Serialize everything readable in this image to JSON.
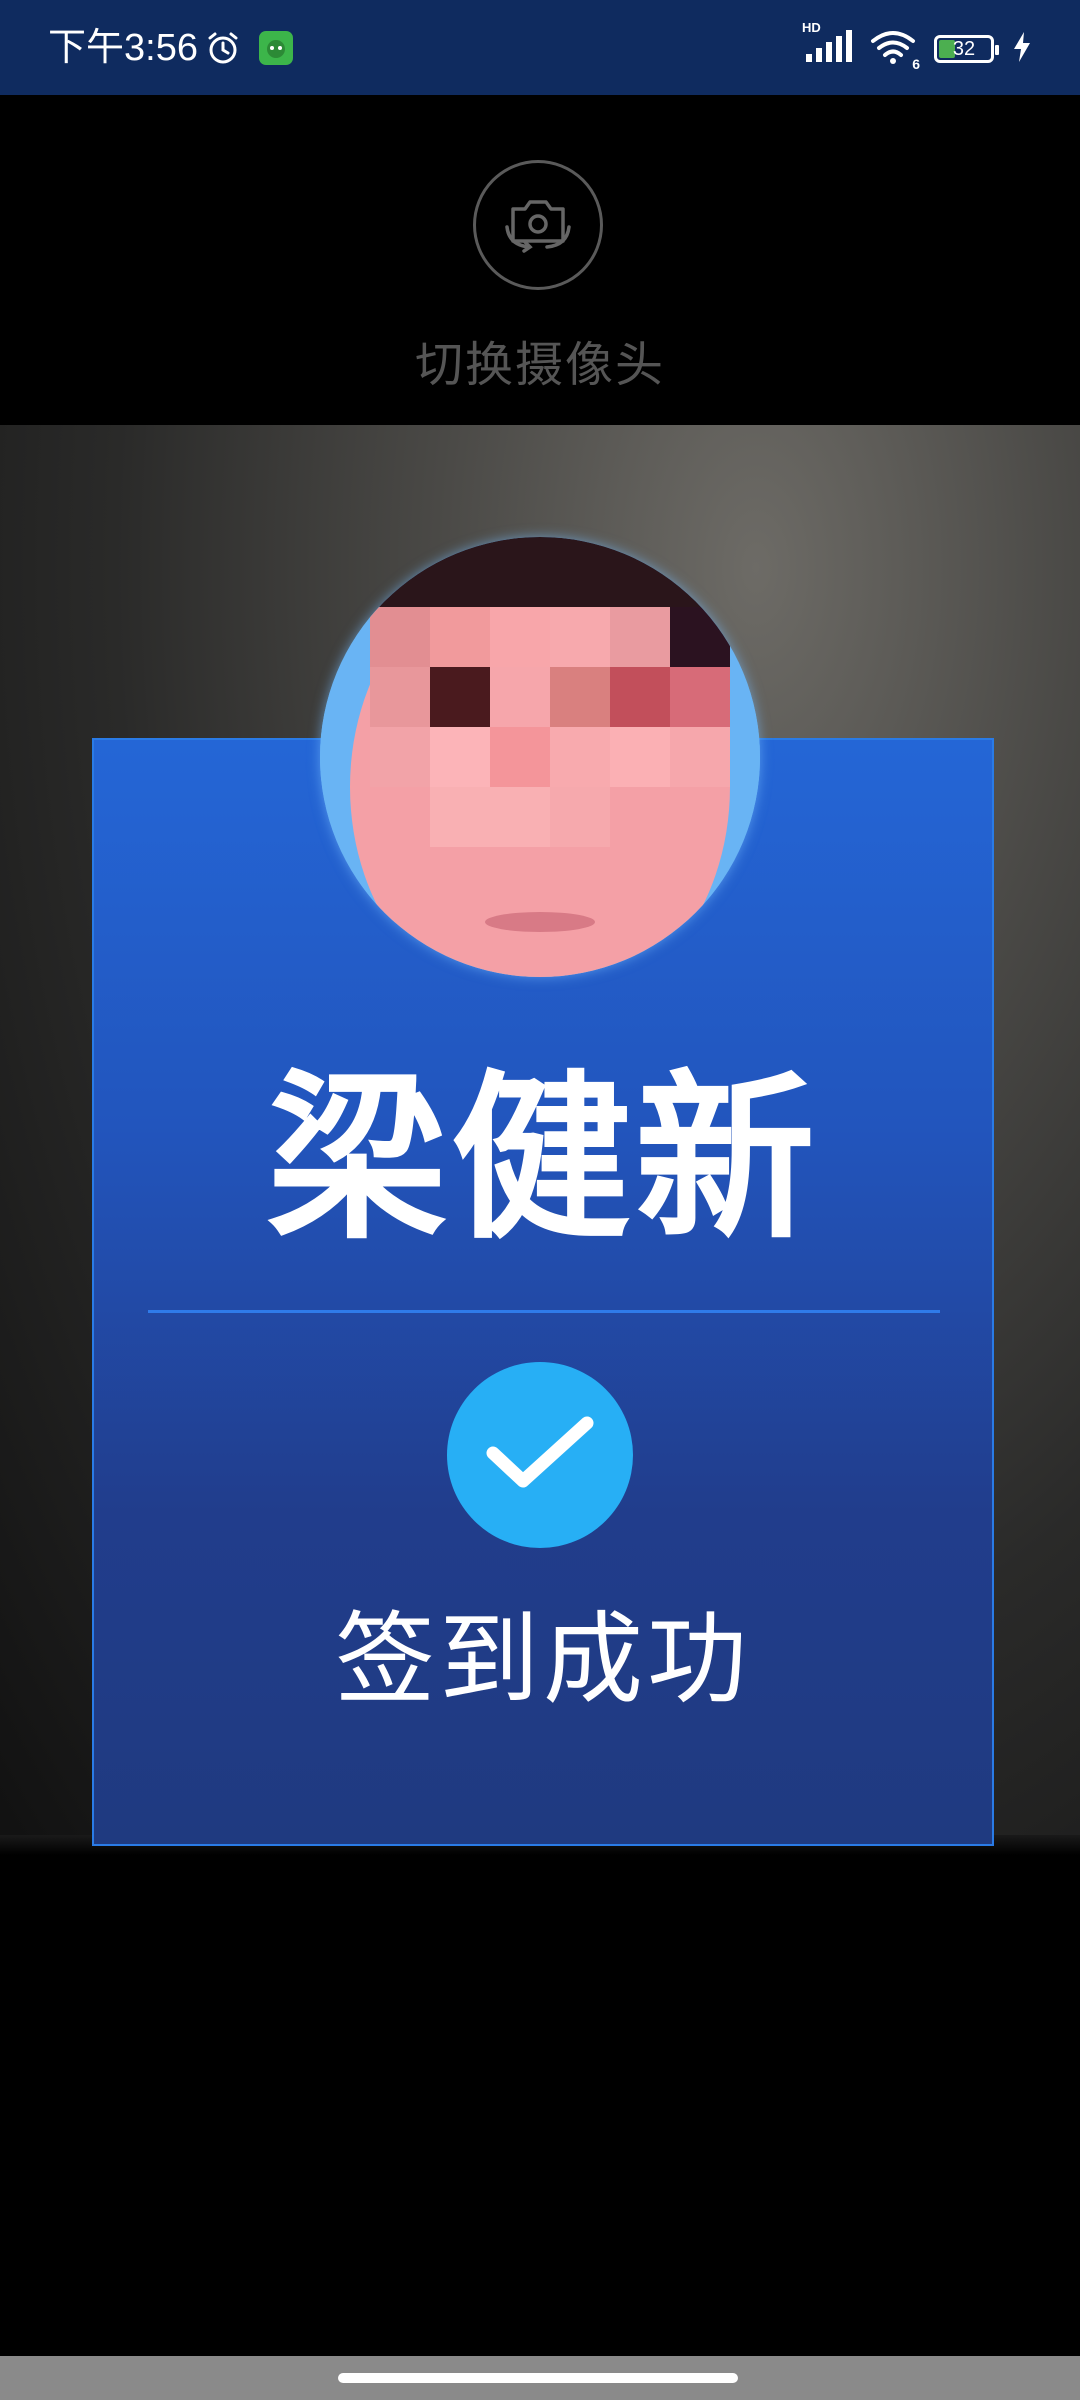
{
  "status_bar": {
    "time": "下午3:56",
    "network_label": "HD",
    "wifi_label": "6",
    "battery_level": "32",
    "battery_fraction": 0.32,
    "icons": [
      "alarm-icon",
      "app-notification-icon",
      "signal-icon",
      "wifi-icon",
      "battery-icon",
      "charging-icon"
    ]
  },
  "camera_header": {
    "switch_icon": "camera-switch-icon",
    "switch_label": "切换摄像头"
  },
  "result": {
    "name": "梁健新",
    "status_icon": "checkmark-icon",
    "status_text": "签到成功"
  },
  "colors": {
    "status_bar_bg": "#0f2b5f",
    "card_blue": "#2466d6",
    "check_blue": "#27aff5"
  }
}
